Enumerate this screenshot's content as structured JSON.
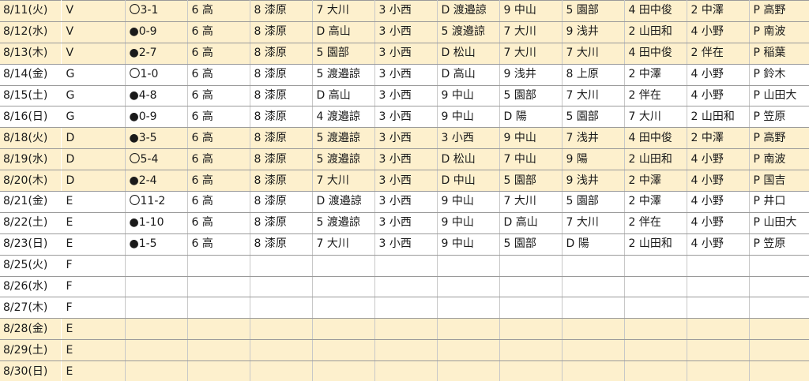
{
  "rows": [
    {
      "hl": true,
      "cells": [
        "8/11(火)",
        "V",
        "〇3-1",
        "6 高",
        "8 漆原",
        "7 大川",
        "3 小西",
        "D 渡邉諒",
        "9 中山",
        "5 園部",
        "4 田中俊",
        "2 中澤",
        "P 高野"
      ]
    },
    {
      "hl": true,
      "cells": [
        "8/12(水)",
        "V",
        "●0-9",
        "6 高",
        "8 漆原",
        "D 高山",
        "3 小西",
        "5 渡邉諒",
        "7 大川",
        "9 浅井",
        "2 山田和",
        "4 小野",
        "P 南波"
      ]
    },
    {
      "hl": true,
      "cells": [
        "8/13(木)",
        "V",
        "●2-7",
        "6 高",
        "8 漆原",
        "5 園部",
        "3 小西",
        "D 松山",
        "7 大川",
        "7 大川",
        "4 田中俊",
        "2 伴在",
        "P 稲葉"
      ]
    },
    {
      "hl": false,
      "cells": [
        "8/14(金)",
        "G",
        "〇1-0",
        "6 高",
        "8 漆原",
        "5 渡邉諒",
        "3 小西",
        "D 高山",
        "9 浅井",
        "8 上原",
        "2 中澤",
        "4 小野",
        "P 鈴木"
      ]
    },
    {
      "hl": false,
      "cells": [
        "8/15(土)",
        "G",
        "●4-8",
        "6 高",
        "8 漆原",
        "D 高山",
        "3 小西",
        "9 中山",
        "5 園部",
        "7 大川",
        "2 伴在",
        "4 小野",
        "P 山田大"
      ]
    },
    {
      "hl": false,
      "cells": [
        "8/16(日)",
        "G",
        "●0-9",
        "6 高",
        "8 漆原",
        "4 渡邉諒",
        "3 小西",
        "9 中山",
        "D 陽",
        "5 園部",
        "7 大川",
        "2 山田和",
        "P 笠原"
      ]
    },
    {
      "hl": true,
      "cells": [
        "8/18(火)",
        "D",
        "●3-5",
        "6 高",
        "8 漆原",
        "5 渡邉諒",
        "3 小西",
        "3 小西",
        "9 中山",
        "7 浅井",
        "4 田中俊",
        "2 中澤",
        "P 高野"
      ]
    },
    {
      "hl": true,
      "cells": [
        "8/19(水)",
        "D",
        "〇5-4",
        "6 高",
        "8 漆原",
        "5 渡邉諒",
        "3 小西",
        "D 松山",
        "7 中山",
        "9 陽",
        "2 山田和",
        "4 小野",
        "P 南波"
      ]
    },
    {
      "hl": true,
      "cells": [
        "8/20(木)",
        "D",
        "●2-4",
        "6 高",
        "8 漆原",
        "7 大川",
        "3 小西",
        "D 中山",
        "5 園部",
        "9 浅井",
        "2 中澤",
        "4 小野",
        "P 国吉"
      ]
    },
    {
      "hl": false,
      "cells": [
        "8/21(金)",
        "E",
        "〇11-2",
        "6 高",
        "8 漆原",
        "D 渡邉諒",
        "3 小西",
        "9 中山",
        "7 大川",
        "5 園部",
        "2 中澤",
        "4 小野",
        "P 井口"
      ]
    },
    {
      "hl": false,
      "cells": [
        "8/22(土)",
        "E",
        "●1-10",
        "6 高",
        "8 漆原",
        "5 渡邉諒",
        "3 小西",
        "9 中山",
        "D 高山",
        "7 大川",
        "2 伴在",
        "4 小野",
        "P 山田大"
      ]
    },
    {
      "hl": false,
      "cells": [
        "8/23(日)",
        "E",
        "●1-5",
        "6 高",
        "8 漆原",
        "7 大川",
        "3 小西",
        "9 中山",
        "5 園部",
        "D 陽",
        "2 山田和",
        "4 小野",
        "P 笠原"
      ]
    },
    {
      "hl": false,
      "cells": [
        "8/25(火)",
        "F",
        "",
        "",
        "",
        "",
        "",
        "",
        "",
        "",
        "",
        "",
        ""
      ]
    },
    {
      "hl": false,
      "cells": [
        "8/26(水)",
        "F",
        "",
        "",
        "",
        "",
        "",
        "",
        "",
        "",
        "",
        "",
        ""
      ]
    },
    {
      "hl": false,
      "cells": [
        "8/27(木)",
        "F",
        "",
        "",
        "",
        "",
        "",
        "",
        "",
        "",
        "",
        "",
        ""
      ]
    },
    {
      "hl": true,
      "cells": [
        "8/28(金)",
        "E",
        "",
        "",
        "",
        "",
        "",
        "",
        "",
        "",
        "",
        "",
        ""
      ]
    },
    {
      "hl": true,
      "cells": [
        "8/29(土)",
        "E",
        "",
        "",
        "",
        "",
        "",
        "",
        "",
        "",
        "",
        "",
        ""
      ]
    },
    {
      "hl": true,
      "cells": [
        "8/30(日)",
        "E",
        "",
        "",
        "",
        "",
        "",
        "",
        "",
        "",
        "",
        "",
        ""
      ]
    }
  ]
}
